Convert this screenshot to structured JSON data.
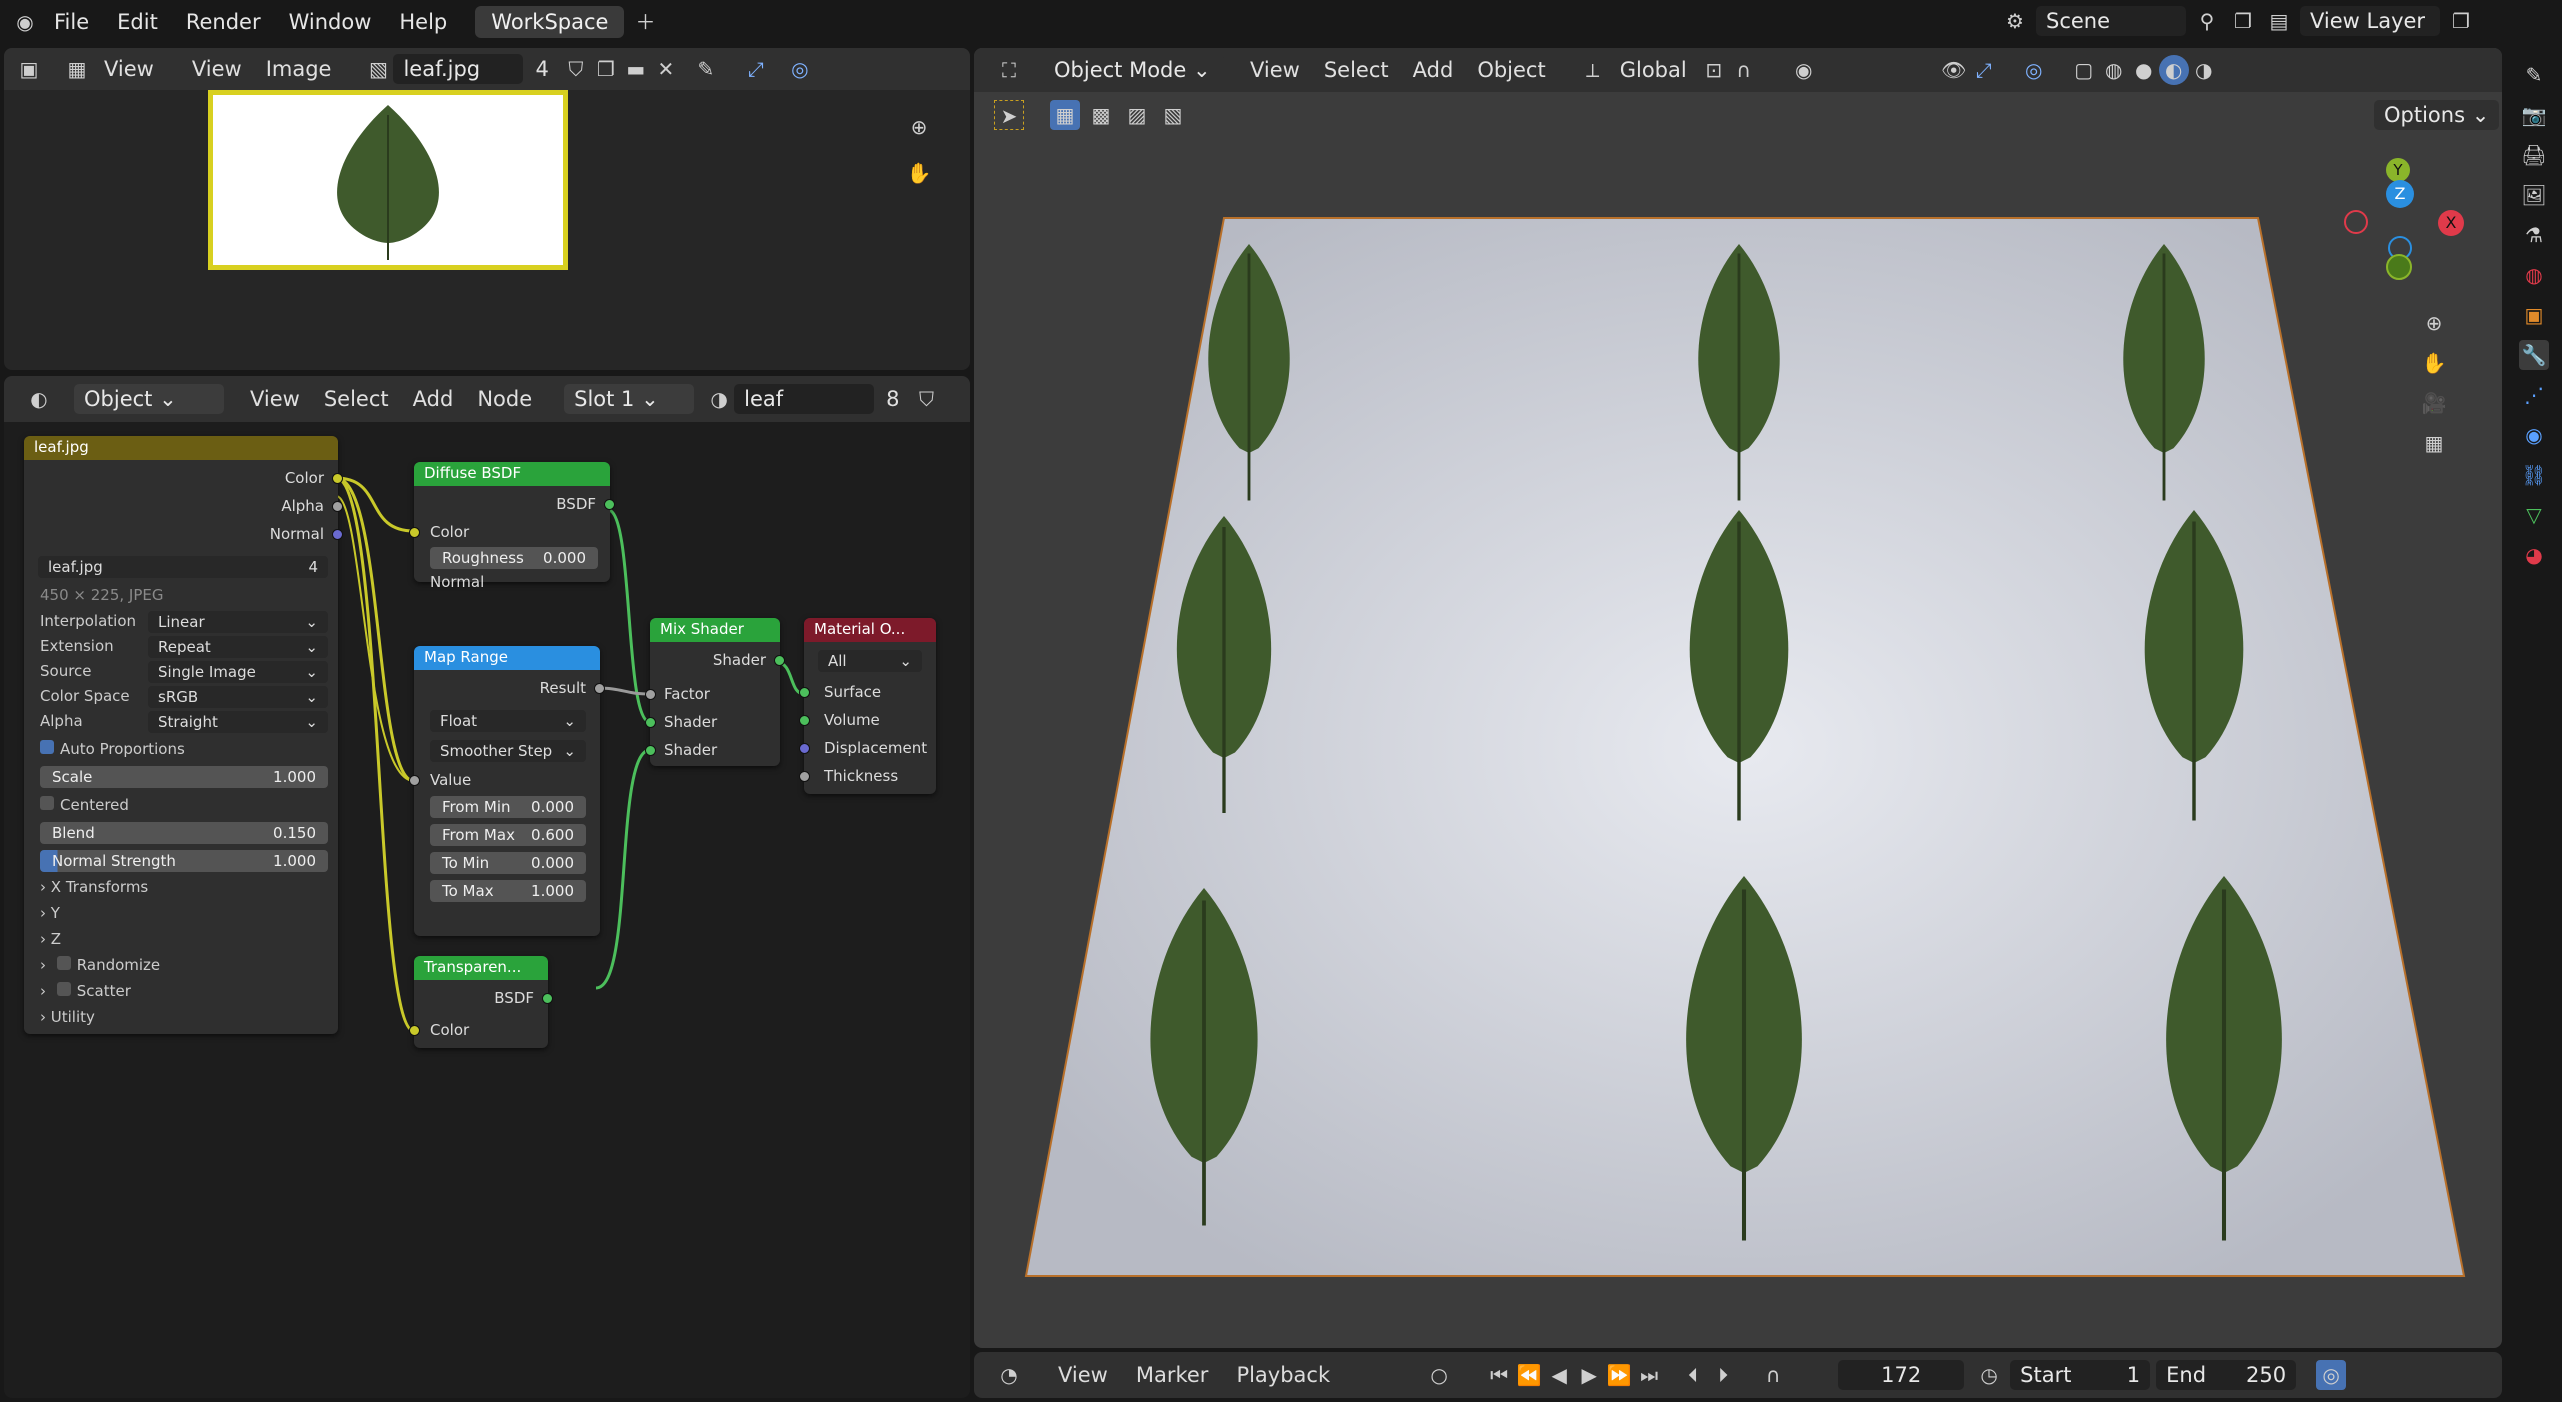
{
  "app": {
    "menus": [
      "File",
      "Edit",
      "Render",
      "Window",
      "Help"
    ],
    "workspace_tab": "WorkSpace",
    "scene": "Scene",
    "view_layer": "View Layer"
  },
  "image_editor": {
    "menus": [
      "View",
      "View",
      "Image"
    ],
    "image_name": "leaf.jpg",
    "users": "4"
  },
  "node_editor": {
    "mode": "Object",
    "menus": [
      "View",
      "Select",
      "Add",
      "Node"
    ],
    "slot": "Slot 1",
    "material": "leaf",
    "users": "8"
  },
  "nodes": {
    "image_texture": {
      "title": "leaf.jpg",
      "outputs": [
        "Color",
        "Alpha",
        "Normal"
      ],
      "image": "leaf.jpg",
      "users": "4",
      "info": "450 × 225, JPEG",
      "props": [
        {
          "label": "Interpolation",
          "value": "Linear"
        },
        {
          "label": "Extension",
          "value": "Repeat"
        },
        {
          "label": "Source",
          "value": "Single Image"
        },
        {
          "label": "Color Space",
          "value": "sRGB"
        },
        {
          "label": "Alpha",
          "value": "Straight"
        }
      ],
      "auto_prop": "Auto Proportions",
      "scale_label": "Scale",
      "scale": "1.000",
      "centered": "Centered",
      "blend_label": "Blend",
      "blend": "0.150",
      "ns_label": "Normal Strength",
      "ns": "1.000",
      "sub": [
        "X Transforms",
        "Y",
        "Z",
        "Randomize",
        "Scatter",
        "Utility"
      ]
    },
    "diffuse": {
      "title": "Diffuse BSDF",
      "output": "BSDF",
      "color": "Color",
      "rough_label": "Roughness",
      "rough": "0.000",
      "normal": "Normal"
    },
    "map_range": {
      "title": "Map Range",
      "output": "Result",
      "type": "Float",
      "interp": "Smoother Step",
      "value": "Value",
      "fields": [
        {
          "label": "From Min",
          "value": "0.000"
        },
        {
          "label": "From Max",
          "value": "0.600"
        },
        {
          "label": "To Min",
          "value": "0.000"
        },
        {
          "label": "To Max",
          "value": "1.000"
        }
      ]
    },
    "mix": {
      "title": "Mix Shader",
      "output": "Shader",
      "factor": "Factor",
      "shader1": "Shader",
      "shader2": "Shader"
    },
    "output": {
      "title": "Material O...",
      "target": "All",
      "inputs": [
        "Surface",
        "Volume",
        "Displacement",
        "Thickness"
      ]
    },
    "transparent": {
      "title": "Transparen...",
      "output": "BSDF",
      "color": "Color"
    }
  },
  "viewport": {
    "mode": "Object Mode",
    "menus": [
      "View",
      "Select",
      "Add",
      "Object"
    ],
    "orientation": "Global",
    "options": "Options",
    "gizmo": {
      "x": "X",
      "y": "Y",
      "z": "Z"
    }
  },
  "timeline": {
    "menus": [
      "View",
      "Marker",
      "Playback"
    ],
    "frame": "172",
    "start_label": "Start",
    "start": "1",
    "end_label": "End",
    "end": "250"
  },
  "colors": {
    "accent": "#4772b3",
    "green_node": "#2aa33b",
    "blue_node": "#2a8fe0",
    "red_node": "#7d1a2a",
    "yellow_link": "#c9c92a",
    "green_link": "#4cbf5c"
  }
}
